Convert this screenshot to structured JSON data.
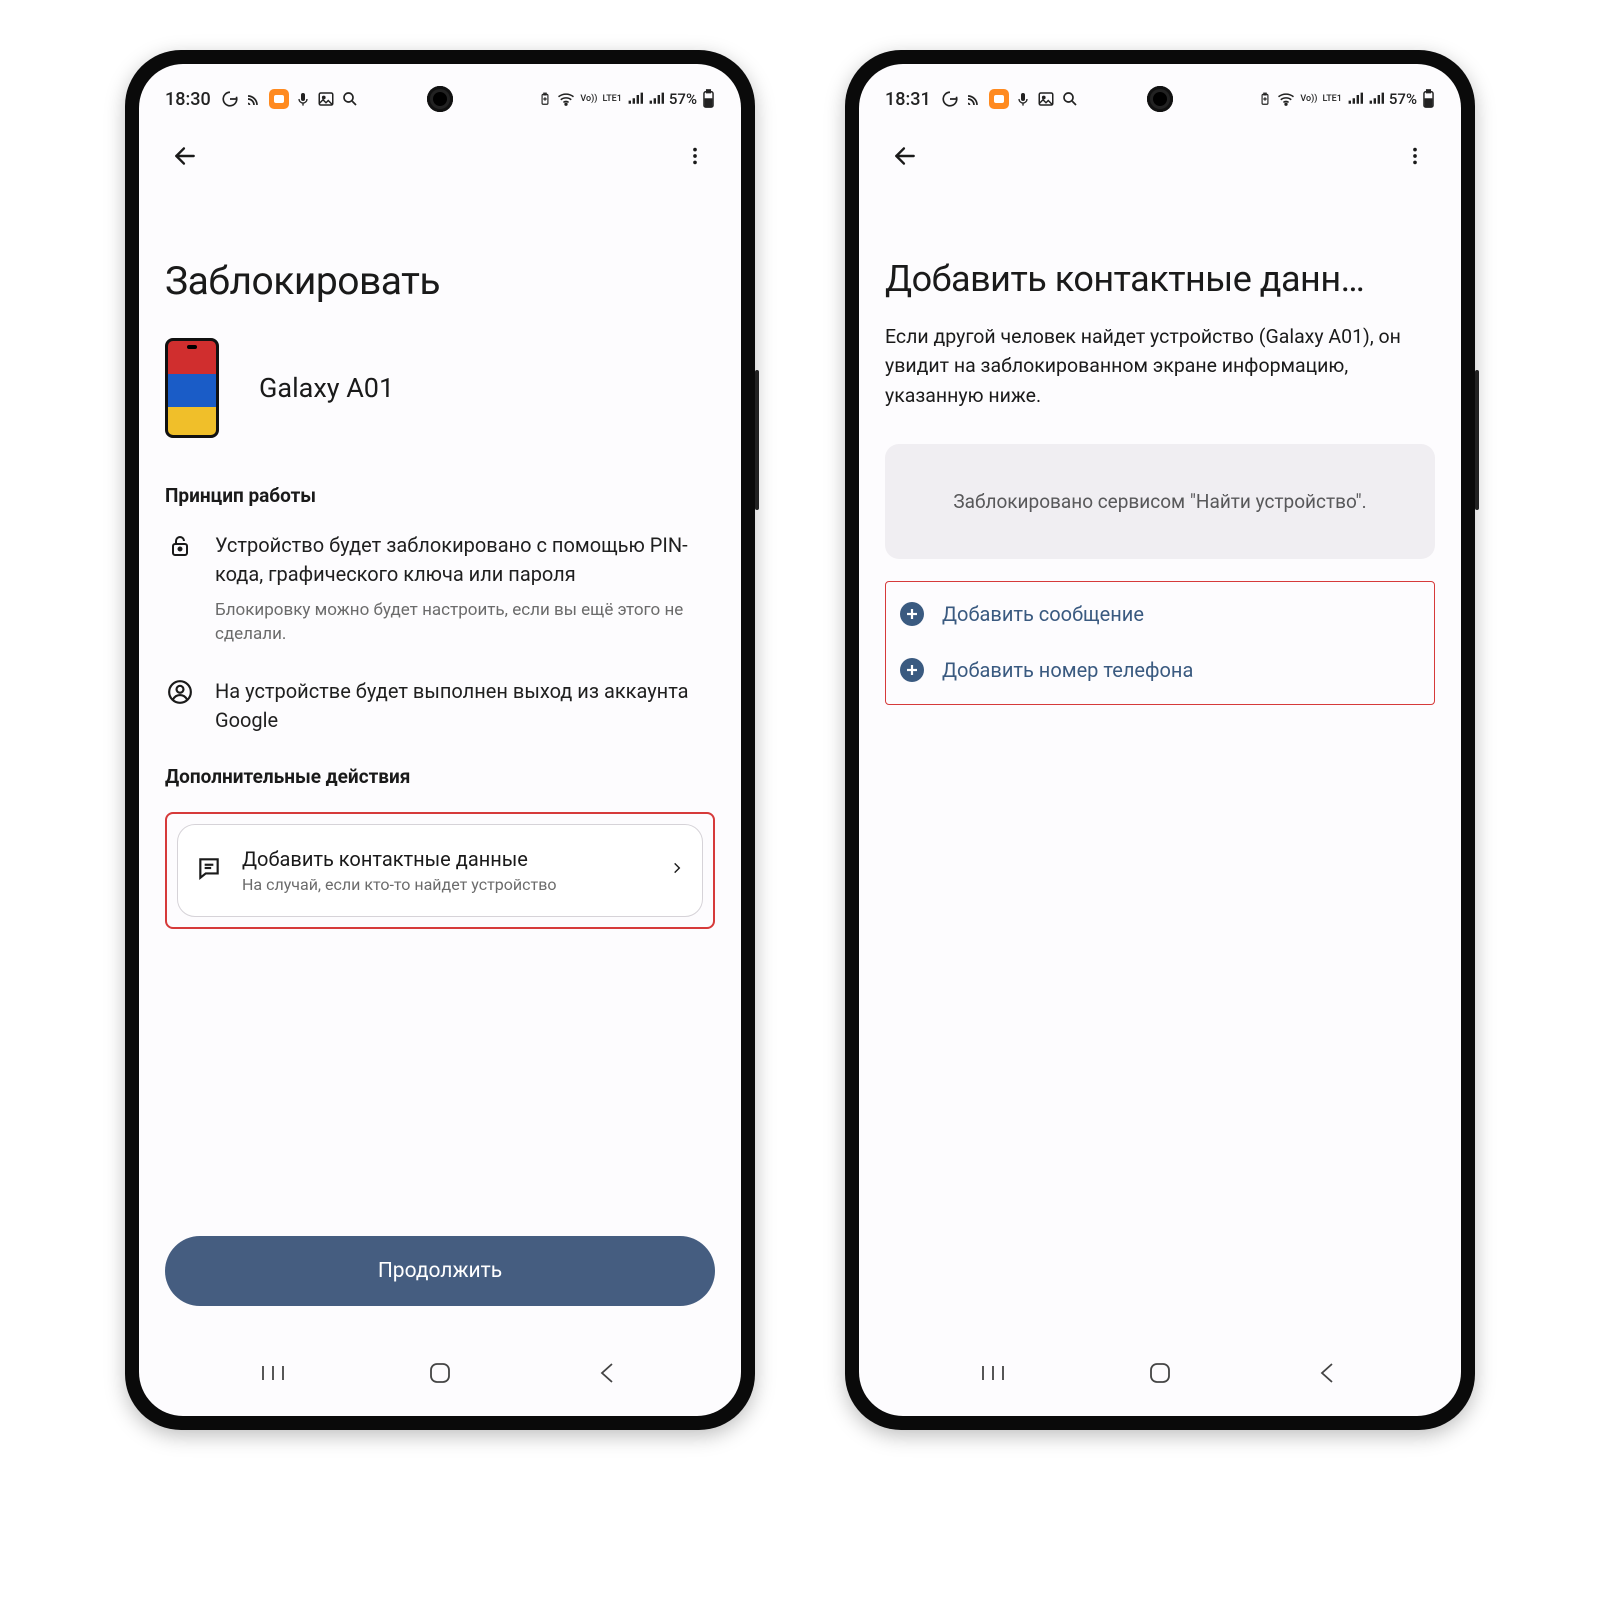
{
  "left": {
    "status": {
      "time": "18:30",
      "battery": "57%",
      "lte": "LTE1",
      "vo": "Vo))"
    },
    "title": "Заблокировать",
    "device_name": "Galaxy A01",
    "section_principle": "Принцип работы",
    "item_lock_text": "Устройство будет заблокировано с помощью PIN-кода, графического ключа или пароля",
    "item_lock_sub": "Блокировку можно будет настроить, если вы ещё этого не сделали.",
    "item_signout": "На устройстве будет выполнен выход из аккаунта Google",
    "section_extra": "Дополнительные действия",
    "card_title": "Добавить контактные данные",
    "card_sub": "На случай, если кто-то найдет устройство",
    "primary": "Продолжить"
  },
  "right": {
    "status": {
      "time": "18:31",
      "battery": "57%",
      "lte": "LTE1",
      "vo": "Vo))"
    },
    "title": "Добавить контактные данн…",
    "descr": "Если другой человек найдет устройство (Galaxy A01), он увидит на заблокированном экране информацию, указанную ниже.",
    "panel_text": "Заблокировано сервисом \"Найти устройство\".",
    "add_msg": "Добавить сообщение",
    "add_phone": "Добавить номер телефона"
  }
}
